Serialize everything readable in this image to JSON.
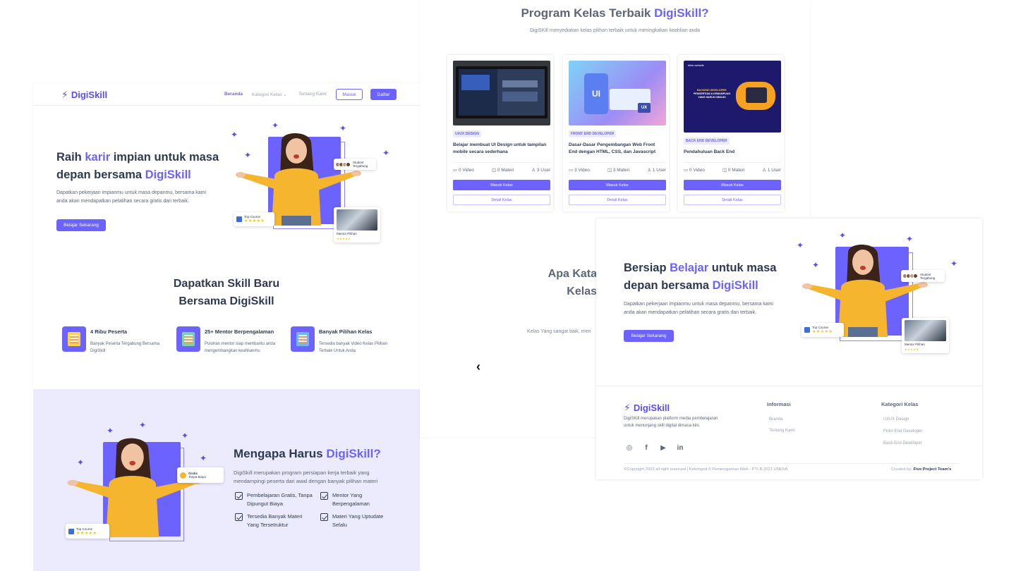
{
  "brand": {
    "name": "DigiSkill",
    "accent": "#6c63ff"
  },
  "nav": {
    "links": [
      "Beranda",
      "Kategori Kelas",
      "Tentang Kami"
    ],
    "login": "Masuk",
    "register": "Daftar"
  },
  "hero": {
    "title_1": "Raih ",
    "title_highlight_1": "karir",
    "title_2": " impian untuk masa",
    "title_3": "depan bersama ",
    "title_highlight_2": "DigiSkill",
    "description": "Dapatkan pekerjaan impianmu untuk masa depanmu, bersama kami anda akan mendapatkan pelatihan secara gratis dan terbaik.",
    "cta": "Belajar Sekarang",
    "card_students": "Student Tergabung",
    "card_top_course": "Top Course",
    "card_mentor": "Mentor Pilihan"
  },
  "skills": {
    "title_line1": "Dapatkan Skill Baru",
    "title_line2": "Bersama DigiSkill",
    "features": [
      {
        "title": "4 Ribu Peserta",
        "desc": "Banyak Peserta Tergabung Bersama DigiSkill"
      },
      {
        "title": "25+ Mentor Berpengalaman",
        "desc": "Puluhan mentor siap membantu anda mengembangkan keahlianmu"
      },
      {
        "title": "Banyak Pilihan Kelas",
        "desc": "Tersedia banyak Video Kelas Pilihan Terbaik Untuk Anda"
      }
    ]
  },
  "why": {
    "title": "Mengapa Harus ",
    "title_highlight": "DigiSkill?",
    "description": "DigiSkill merupakan program persiapan kerja terbaik yang mendampingi peserta dari awal dengan banyak pilihan materi",
    "card_free_title": "Gratis",
    "card_free_sub": "Tanpa Biaya",
    "card_top_course": "Top Course",
    "checks": [
      "Pembelajaran Gratis, Tanpa Dipungut Biaya",
      "Mentor Yang Berpengalaman",
      "Tersedia Banyak Materi Yang Tersetruktur",
      "Materi Yang Uptudate Selalu"
    ]
  },
  "programs": {
    "title": "Program Kelas Terbaik ",
    "title_highlight": "DigiSkill?",
    "subtitle": "DigiSKill menyediakan kelas pilihan terbaik untuk meningkakan keahlian anda",
    "courses": [
      {
        "tag": "UI/UX DESIGN",
        "name": "Belajar membuat UI Design untuk tampilan mobile secara sederhana",
        "videos": "0 Video",
        "materials": "0 Materi",
        "users": "3 User",
        "enter": "Masuk Kelas",
        "detail": "Detail Kelas"
      },
      {
        "tag": "FRONT END DEVELOPER",
        "name": "Dasar-Dasar Pengembangan Web Front End dengan HTML, CSS, dan Javascript",
        "videos": "3 Video",
        "materials": "3 Materi",
        "users": "1 User",
        "enter": "Masuk Kelas",
        "detail": "Detail Kelas",
        "thumb_label_1": "UI",
        "thumb_label_2": "UX"
      },
      {
        "tag": "BACK END DEVELOPER",
        "name": "Pendahuluan Back End",
        "videos": "0 Video",
        "materials": "0 Materi",
        "users": "1 User",
        "enter": "Masuk Kelas",
        "detail": "Detail Kelas",
        "thumb_header": "bikin.website",
        "thumb_text_1": "BACKEND DEVELOPER:",
        "thumb_text_2": "PENGERTIAN & KEMAMPUAN",
        "thumb_text_3": "YANG HARUS DIMILIKI"
      }
    ],
    "testimonial_title_1": "Apa Kata",
    "testimonial_title_2": "Kelas",
    "testimonial_text": "Kelas Yang sangat baik, men",
    "prev_arrow": "‹"
  },
  "cta_section": {
    "title_1": "Bersiap ",
    "title_highlight_1": "Belajar",
    "title_2": " untuk masa",
    "title_3": "depan bersama ",
    "title_highlight_2": "DigiSkill",
    "description": "Dapatkan pekerjaan impianmu untuk masa depanmu, bersama kami anda akan mendapatkan pelatihan secara gratis dan terbaik.",
    "cta": "Belajar Sekarang"
  },
  "footer": {
    "about": "DigiSKill merupakan platform media pembelajaran untuk menunjang skill digital dimasa kini.",
    "info_title": "Informasi",
    "info_links": [
      "Branda",
      "Tentang Kami"
    ],
    "category_title": "Kategori Kelas",
    "category_links": [
      "UI/UX Design",
      "Front End Developer",
      "Back End Developer"
    ],
    "socials": [
      "instagram-icon",
      "facebook-icon",
      "youtube-icon",
      "linkedin-icon"
    ],
    "copyright": "©Copyright 2023 all right reserved | Kelompok 5 Pemerogaman Web - PTI-B 2021 UNESA",
    "created_by_label": "Created by: ",
    "created_by": "Five Project Team's"
  }
}
